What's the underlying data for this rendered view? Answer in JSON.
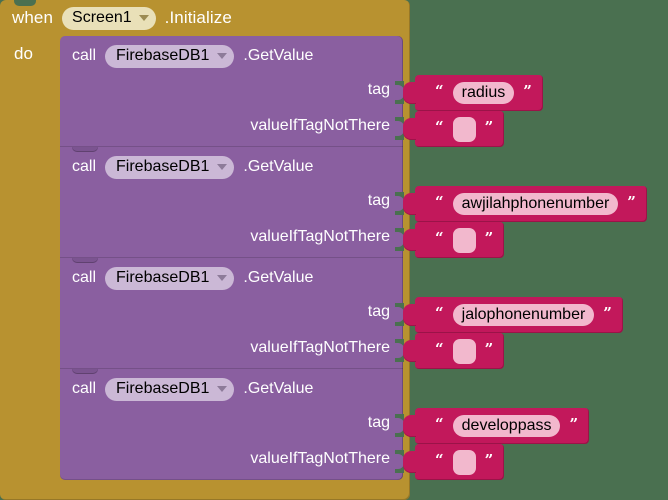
{
  "canvas": {
    "background_color": "#4a7050"
  },
  "event_block": {
    "color": "#b89230",
    "when_label": "when",
    "component": "Screen1",
    "event_name": ".Initialize",
    "do_label": "do",
    "dropdown_icon": "chevron-down-icon"
  },
  "call_blocks": [
    {
      "color": "#8a5fa0",
      "call_label": "call",
      "component": "FirebaseDB1",
      "method_name": ".GetValue",
      "dropdown_icon": "chevron-down-icon",
      "args": [
        {
          "label": "tag",
          "value_block": {
            "type": "text",
            "color": "#c2185b",
            "open_quote": "“",
            "close_quote": "”",
            "value": "radius",
            "empty": false
          }
        },
        {
          "label": "valueIfTagNotThere",
          "value_block": {
            "type": "text",
            "color": "#c2185b",
            "open_quote": "“",
            "close_quote": "”",
            "value": "",
            "empty": true
          }
        }
      ]
    },
    {
      "color": "#8a5fa0",
      "call_label": "call",
      "component": "FirebaseDB1",
      "method_name": ".GetValue",
      "dropdown_icon": "chevron-down-icon",
      "args": [
        {
          "label": "tag",
          "value_block": {
            "type": "text",
            "color": "#c2185b",
            "open_quote": "“",
            "close_quote": "”",
            "value": "awjilahphonenumber",
            "empty": false
          }
        },
        {
          "label": "valueIfTagNotThere",
          "value_block": {
            "type": "text",
            "color": "#c2185b",
            "open_quote": "“",
            "close_quote": "”",
            "value": "",
            "empty": true
          }
        }
      ]
    },
    {
      "color": "#8a5fa0",
      "call_label": "call",
      "component": "FirebaseDB1",
      "method_name": ".GetValue",
      "dropdown_icon": "chevron-down-icon",
      "args": [
        {
          "label": "tag",
          "value_block": {
            "type": "text",
            "color": "#c2185b",
            "open_quote": "“",
            "close_quote": "”",
            "value": "jalophonenumber",
            "empty": false
          }
        },
        {
          "label": "valueIfTagNotThere",
          "value_block": {
            "type": "text",
            "color": "#c2185b",
            "open_quote": "“",
            "close_quote": "”",
            "value": "",
            "empty": true
          }
        }
      ]
    },
    {
      "color": "#8a5fa0",
      "call_label": "call",
      "component": "FirebaseDB1",
      "method_name": ".GetValue",
      "dropdown_icon": "chevron-down-icon",
      "args": [
        {
          "label": "tag",
          "value_block": {
            "type": "text",
            "color": "#c2185b",
            "open_quote": "“",
            "close_quote": "”",
            "value": "developpass",
            "empty": false
          }
        },
        {
          "label": "valueIfTagNotThere",
          "value_block": {
            "type": "text",
            "color": "#c2185b",
            "open_quote": "“",
            "close_quote": "”",
            "value": "",
            "empty": true
          }
        }
      ]
    }
  ]
}
